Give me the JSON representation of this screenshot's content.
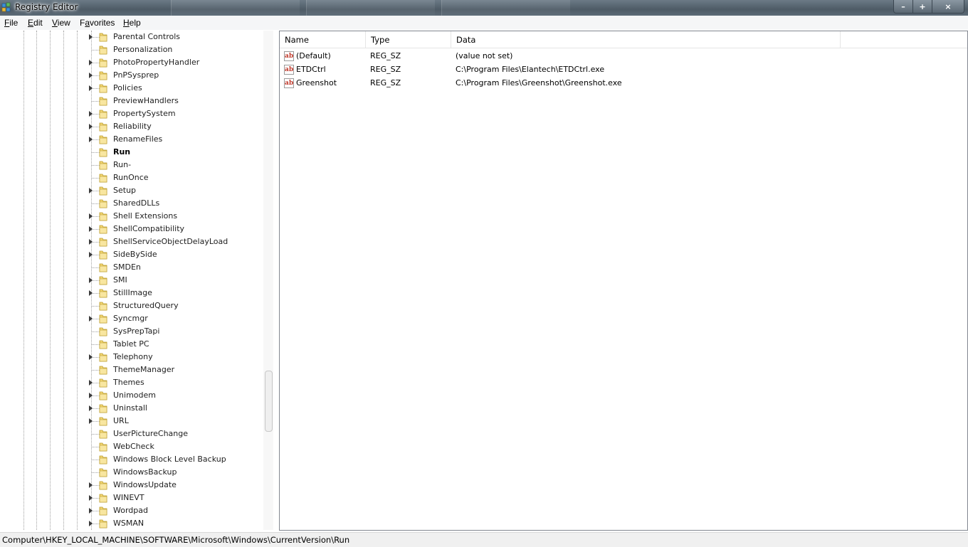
{
  "window": {
    "title": "Registry Editor",
    "controls": {
      "minimize": "–",
      "maximize": "+",
      "close": "×"
    }
  },
  "menu": [
    {
      "label": "File",
      "accel_index": 0
    },
    {
      "label": "Edit",
      "accel_index": 0
    },
    {
      "label": "View",
      "accel_index": 0
    },
    {
      "label": "Favorites",
      "accel_index": 1
    },
    {
      "label": "Help",
      "accel_index": 0
    }
  ],
  "tree": {
    "items": [
      {
        "label": "Parental Controls",
        "expandable": true,
        "selected": false
      },
      {
        "label": "Personalization",
        "expandable": false,
        "selected": false
      },
      {
        "label": "PhotoPropertyHandler",
        "expandable": true,
        "selected": false
      },
      {
        "label": "PnPSysprep",
        "expandable": true,
        "selected": false
      },
      {
        "label": "Policies",
        "expandable": true,
        "selected": false
      },
      {
        "label": "PreviewHandlers",
        "expandable": false,
        "selected": false
      },
      {
        "label": "PropertySystem",
        "expandable": true,
        "selected": false
      },
      {
        "label": "Reliability",
        "expandable": true,
        "selected": false
      },
      {
        "label": "RenameFiles",
        "expandable": true,
        "selected": false
      },
      {
        "label": "Run",
        "expandable": false,
        "selected": true
      },
      {
        "label": "Run-",
        "expandable": false,
        "selected": false
      },
      {
        "label": "RunOnce",
        "expandable": false,
        "selected": false
      },
      {
        "label": "Setup",
        "expandable": true,
        "selected": false
      },
      {
        "label": "SharedDLLs",
        "expandable": false,
        "selected": false
      },
      {
        "label": "Shell Extensions",
        "expandable": true,
        "selected": false
      },
      {
        "label": "ShellCompatibility",
        "expandable": true,
        "selected": false
      },
      {
        "label": "ShellServiceObjectDelayLoad",
        "expandable": true,
        "selected": false
      },
      {
        "label": "SideBySide",
        "expandable": true,
        "selected": false
      },
      {
        "label": "SMDEn",
        "expandable": false,
        "selected": false
      },
      {
        "label": "SMI",
        "expandable": true,
        "selected": false
      },
      {
        "label": "StillImage",
        "expandable": true,
        "selected": false
      },
      {
        "label": "StructuredQuery",
        "expandable": false,
        "selected": false
      },
      {
        "label": "Syncmgr",
        "expandable": true,
        "selected": false
      },
      {
        "label": "SysPrepTapi",
        "expandable": false,
        "selected": false
      },
      {
        "label": "Tablet PC",
        "expandable": false,
        "selected": false
      },
      {
        "label": "Telephony",
        "expandable": true,
        "selected": false
      },
      {
        "label": "ThemeManager",
        "expandable": false,
        "selected": false
      },
      {
        "label": "Themes",
        "expandable": true,
        "selected": false
      },
      {
        "label": "Unimodem",
        "expandable": true,
        "selected": false
      },
      {
        "label": "Uninstall",
        "expandable": true,
        "selected": false
      },
      {
        "label": "URL",
        "expandable": true,
        "selected": false
      },
      {
        "label": "UserPictureChange",
        "expandable": false,
        "selected": false
      },
      {
        "label": "WebCheck",
        "expandable": false,
        "selected": false
      },
      {
        "label": "Windows Block Level Backup",
        "expandable": false,
        "selected": false
      },
      {
        "label": "WindowsBackup",
        "expandable": false,
        "selected": false
      },
      {
        "label": "WindowsUpdate",
        "expandable": true,
        "selected": false
      },
      {
        "label": "WINEVT",
        "expandable": true,
        "selected": false
      },
      {
        "label": "Wordpad",
        "expandable": true,
        "selected": false
      },
      {
        "label": "WSMAN",
        "expandable": true,
        "selected": false
      }
    ]
  },
  "values": {
    "columns": {
      "name": "Name",
      "type": "Type",
      "data": "Data"
    },
    "rows": [
      {
        "name": "(Default)",
        "type": "REG_SZ",
        "data": "(value not set)",
        "icon": "ab-string-icon"
      },
      {
        "name": "ETDCtrl",
        "type": "REG_SZ",
        "data": "C:\\Program Files\\Elantech\\ETDCtrl.exe",
        "icon": "ab-string-icon"
      },
      {
        "name": "Greenshot",
        "type": "REG_SZ",
        "data": "C:\\Program Files\\Greenshot\\Greenshot.exe",
        "icon": "ab-string-icon"
      }
    ]
  },
  "status": {
    "path": "Computer\\HKEY_LOCAL_MACHINE\\SOFTWARE\\Microsoft\\Windows\\CurrentVersion\\Run"
  }
}
